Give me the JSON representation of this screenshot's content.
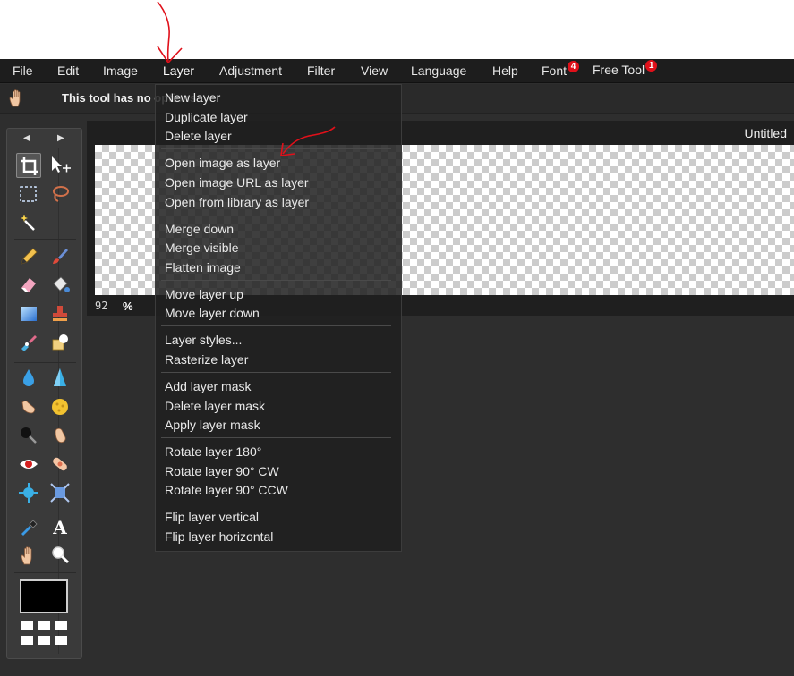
{
  "menubar": {
    "items": [
      {
        "label": "File"
      },
      {
        "label": "Edit"
      },
      {
        "label": "Image"
      },
      {
        "label": "Layer"
      },
      {
        "label": "Adjustment"
      },
      {
        "label": "Filter"
      },
      {
        "label": "View"
      },
      {
        "label": "Language"
      },
      {
        "label": "Help"
      },
      {
        "label": "Font",
        "badge": "4"
      },
      {
        "label": "Free Tool",
        "badge": "1"
      }
    ]
  },
  "options_bar": {
    "text": "This tool has no options"
  },
  "document": {
    "title": "Untitled",
    "zoom_value": "92",
    "zoom_unit": "%"
  },
  "layer_menu": {
    "items": [
      "New layer",
      "Duplicate layer",
      "Delete layer",
      "Open image as layer",
      "Open image URL as layer",
      "Open from library as layer",
      "Merge down",
      "Merge visible",
      "Flatten image",
      "Move layer up",
      "Move layer down",
      "Layer styles...",
      "Rasterize layer",
      "Add layer mask",
      "Delete layer mask",
      "Apply layer mask",
      "Rotate layer 180°",
      "Rotate layer 90° CW",
      "Rotate layer 90° CCW",
      "Flip layer vertical",
      "Flip layer horizontal"
    ]
  },
  "toolbox": {
    "collapse_left": "◀",
    "collapse_right": "▶",
    "tools": [
      "crop-icon",
      "move-icon",
      "marquee-icon",
      "lasso-icon",
      "magic-wand-icon",
      "pencil-icon",
      "brush-icon",
      "eraser-icon",
      "bucket-icon",
      "gradient-icon",
      "stamp-icon",
      "color-replace-icon",
      "shape-icon",
      "drop-icon",
      "sharpen-icon",
      "smudge-icon",
      "sponge-icon",
      "burn-icon",
      "dodge-icon",
      "red-eye-icon",
      "spot-heal-icon",
      "bloat-icon",
      "pinch-icon",
      "eyedropper-icon",
      "type-icon",
      "hand-icon",
      "zoom-icon"
    ],
    "foreground_color": "#000000"
  },
  "colors": {
    "menubar_bg": "#1d1d1d",
    "badge_red": "#e0101a",
    "annotation_red": "#e0101a"
  }
}
